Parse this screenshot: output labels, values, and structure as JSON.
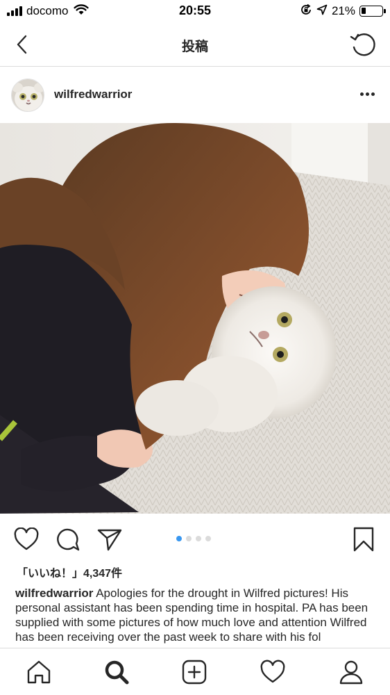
{
  "status_bar": {
    "carrier": "docomo",
    "time": "20:55",
    "battery_percent": "21%",
    "battery_level": 0.21,
    "icons": [
      "signal-icon",
      "wifi-icon",
      "orientation-lock-icon",
      "location-icon",
      "battery-icon"
    ]
  },
  "nav": {
    "title": "投稿",
    "back_icon": "chevron-left-icon",
    "refresh_icon": "refresh-icon"
  },
  "post": {
    "username": "wilfredwarrior",
    "more_icon": "more-horizontal-icon",
    "photo_description_icon": "post-photo",
    "carousel": {
      "count": 4,
      "active_index": 0
    },
    "likes": "「いいね！」4,347件",
    "caption_username": "wilfredwarrior",
    "caption_text": " Apologies for the drought in Wilfred pictures! His personal assistant has been spending time in hospital. PA has been supplied with some pictures of how much love and attention Wilfred has been receiving over the past week to share with his fol"
  },
  "colors": {
    "accent": "#3897f0",
    "text": "#262626",
    "divider": "#dbdbdb"
  },
  "tabbar": {
    "items": [
      "home-icon",
      "search-icon",
      "new-post-icon",
      "activity-heart-icon",
      "profile-icon"
    ]
  }
}
